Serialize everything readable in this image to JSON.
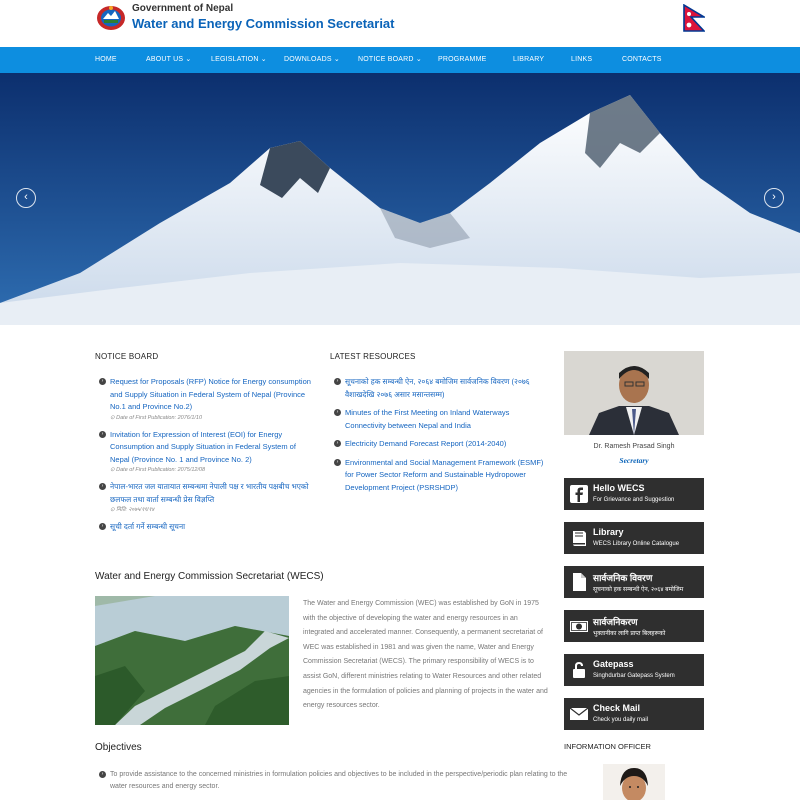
{
  "header": {
    "gov_label": "Government of Nepal",
    "org_name": "Water and Energy Commission Secretariat"
  },
  "nav": {
    "items": [
      {
        "label": "HOME",
        "dropdown": false
      },
      {
        "label": "ABOUT US",
        "dropdown": true
      },
      {
        "label": "LEGISLATION",
        "dropdown": true
      },
      {
        "label": "DOWNLOADS",
        "dropdown": true
      },
      {
        "label": "NOTICE BOARD",
        "dropdown": true
      },
      {
        "label": "PROGRAMME",
        "dropdown": false
      },
      {
        "label": "LIBRARY",
        "dropdown": false
      },
      {
        "label": "LINKS",
        "dropdown": false
      },
      {
        "label": "CONTACTS",
        "dropdown": false
      }
    ]
  },
  "slider": {
    "prev_icon": "chevron-left-icon",
    "next_icon": "chevron-right-icon",
    "prev": "‹",
    "next": "›"
  },
  "notice_board": {
    "heading": "NOTICE BOARD",
    "items": [
      {
        "title": "Request for Proposals (RFP) Notice for Energy consumption and Supply Situation in Federal System of Nepal (Province No.1 and Province No.2)",
        "date": "Date of First Publication: 2076/1/10"
      },
      {
        "title": "Invitation for Expression of Interest (EOI) for Energy Consumption and Supply Situation in Federal System of Nepal (Province No. 1 and Province No. 2)",
        "date": "Date of First Publication: 2075/12/08"
      },
      {
        "title": "नेपाल-भारत जल यातायात सम्बन्धमा नेपाली पक्ष र भारतीय पक्षबीच भएको छलफल तथा वार्ता सम्बन्धी प्रेस विज्ञप्ति",
        "date": "मिति: २०७५/११/१४"
      },
      {
        "title": "सूची दर्ता गर्ने सम्बन्धी सूचना",
        "date": ""
      }
    ]
  },
  "latest_resources": {
    "heading": "LATEST RESOURCES",
    "items": [
      {
        "title": "सूचनाको हक सम्बन्धी ऐन, २०६४ बमोजिम सार्वजनिक विवरण (२०७६ वैशाखदेखि २०७६ असार मसान्तसम्म)"
      },
      {
        "title": "Minutes of the First Meeting on Inland Waterways Connectivity between Nepal and India"
      },
      {
        "title": "Electricity Demand Forecast Report (2014-2040)"
      },
      {
        "title": "Environmental and Social Management Framework (ESMF) for Power Sector Reform and Sustainable Hydropower Development Project (PSRSHDP)"
      }
    ]
  },
  "about": {
    "title": "Water and Energy Commission Secretariat (WECS)",
    "body": "The Water and Energy Commission (WEC) was established by GoN in 1975 with the objective of developing the water and energy resources in an integrated and accelerated manner. Consequently, a permanent secretariat of WEC was established in 1981 and was given the name, Water and Energy Commission Secretariat (WECS). The primary responsibility of WECS is to assist GoN, different ministries relating to Water Resources and other related agencies in the formulation of policies and planning of projects in the water and energy resources sector."
  },
  "objectives": {
    "title": "Objectives",
    "items": [
      "To provide assistance to the concerned ministries in formulation policies and objectives to be included in the perspective/periodic plan relating to the water resources and energy sector."
    ]
  },
  "secretary": {
    "name": "Dr. Ramesh Prasad Singh",
    "role": "Secretary"
  },
  "side_buttons": [
    {
      "title": "Hello WECS",
      "subtitle": "For Grievance and Suggestion",
      "icon": "facebook-icon"
    },
    {
      "title": "Library",
      "subtitle": "WECS Library Online Catalogue",
      "icon": "book-icon"
    },
    {
      "title": "सार्वजनिक विवरण",
      "subtitle": "सूचनाको हक सम्बन्धी ऐन, २०६४ बमोजिम",
      "icon": "document-icon"
    },
    {
      "title": "सार्वजनिकरण",
      "subtitle": "भुक्तानीका लागि प्राप्त बिलहरूको",
      "icon": "money-icon"
    },
    {
      "title": "Gatepass",
      "subtitle": "Singhdurbar Gatepass System",
      "icon": "lock-icon"
    },
    {
      "title": "Check Mail",
      "subtitle": "Check you daily mail",
      "icon": "mail-icon"
    }
  ],
  "information_officer": {
    "heading": "INFORMATION OFFICER"
  },
  "colors": {
    "nav": "#0d8ee0",
    "link": "#1565c0",
    "brand": "#0a63b8",
    "side_button": "#2f2f2f"
  }
}
